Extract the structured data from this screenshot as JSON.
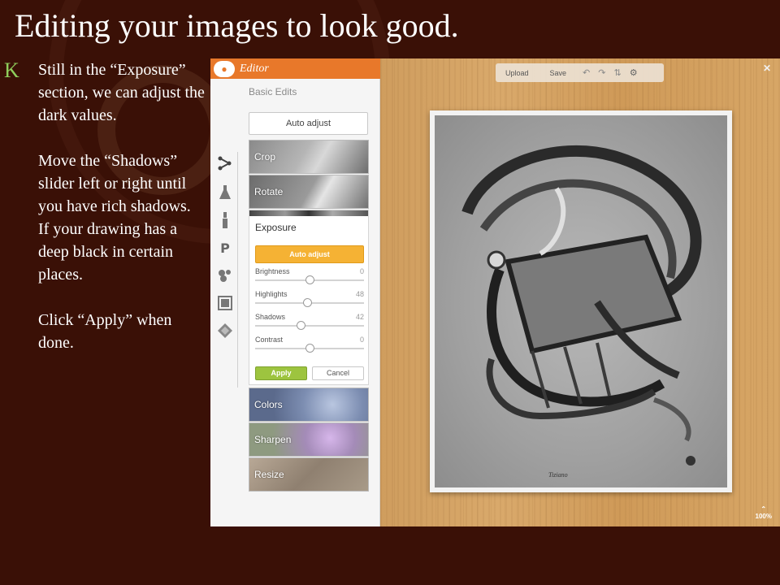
{
  "slide": {
    "title": "Editing your images to look good.",
    "bullet_letter": "K",
    "paragraphs": [
      "Still in the “Exposure” section, we can adjust the dark values.",
      "Move the “Shadows” slider left or right until you have rich shadows. If your drawing has a deep black in certain places.",
      "Click “Apply” when done."
    ]
  },
  "editor": {
    "title": "Editor",
    "section_heading": "Basic Edits",
    "auto_adjust_label": "Auto adjust",
    "tools": [
      {
        "label": "Crop"
      },
      {
        "label": "Rotate"
      },
      {
        "label": "Colors"
      },
      {
        "label": "Sharpen"
      },
      {
        "label": "Resize"
      }
    ],
    "rail_icons": [
      "effects-icon",
      "flask-icon",
      "brush-icon",
      "text-p-icon",
      "overlay-icon",
      "frame-icon",
      "texture-icon"
    ],
    "exposure": {
      "title": "Exposure",
      "auto_adjust_label": "Auto adjust",
      "sliders": [
        {
          "label": "Brightness",
          "value": "0",
          "level": 0.5
        },
        {
          "label": "Highlights",
          "value": "48",
          "level": 0.48
        },
        {
          "label": "Shadows",
          "value": "42",
          "level": 0.42
        },
        {
          "label": "Contrast",
          "value": "0",
          "level": 0.5
        }
      ],
      "apply_label": "Apply",
      "cancel_label": "Cancel"
    }
  },
  "toolbar": {
    "upload_label": "Upload",
    "save_label": "Save",
    "icons": [
      "undo-icon",
      "redo-icon",
      "history-icon",
      "gear-icon"
    ]
  },
  "canvas": {
    "close_icon": "close-icon",
    "zoom_label": "100%",
    "signature_text": "Tiziano"
  },
  "colors": {
    "slide_background": "#3a1006",
    "bullet": "#8fce5c",
    "editor_header": "#e8782a",
    "auto_adjust_button": "#f5b234",
    "apply_button": "#9dc43f"
  }
}
